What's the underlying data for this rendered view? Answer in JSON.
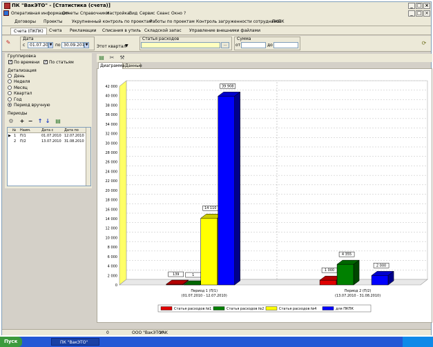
{
  "window": {
    "title": "ПК \"ВакЭТО\" - [Статистика (счета)]",
    "min": "_",
    "max": "□",
    "close": "×",
    "child_min": "_",
    "child_max": "□",
    "child_close": "×"
  },
  "menu": [
    "Оперативная информация",
    "Отчеты",
    "Справочники",
    "Настройка",
    "Вид",
    "Сервис",
    "Сеанс",
    "Окно",
    "?"
  ],
  "tabs1": [
    "Договоры",
    "Проекты",
    "Укрупненный контроль по проектам",
    "Работы по проектам",
    "Контроль загруженности сотрудников",
    "ПКПК"
  ],
  "tabs2": [
    "Счета (ПКПК)",
    "Счета",
    "Рекламации",
    "Списания в утиль",
    "Складской запас",
    "Управление внешними файлами"
  ],
  "filter": {
    "date_label": "Дата",
    "from_label": "с",
    "from": "01.07.2010",
    "to_label": "по",
    "to": "30.09.2010",
    "period": "Этот квартал",
    "expense_label": "Статья расходов",
    "expense_value": "",
    "browse": "...",
    "sum_label": "Сумма",
    "sum_from_label": "от",
    "sum_from": "",
    "sum_to_label": "до",
    "sum_to": ""
  },
  "left": {
    "grouping_label": "Группировка",
    "by_time": "По времени",
    "by_items": "По статьям",
    "detail_label": "Детализация",
    "detail_options": [
      "День",
      "Неделя",
      "Месяц",
      "Квартал",
      "Год",
      "Период вручную"
    ],
    "detail_selected_index": 5,
    "periods_label": "Периоды",
    "tool_add": "+",
    "tool_remove": "−",
    "tool_up": "↑",
    "tool_down": "↓",
    "columns": [
      "№",
      "Наим.",
      "Дата с",
      "Дата по"
    ],
    "rows": [
      [
        "1",
        "П/1",
        "01.07.2010",
        "12.07.2010"
      ],
      [
        "2",
        "П/2",
        "13.07.2010",
        "31.08.2010"
      ]
    ]
  },
  "chart_tabs": [
    "Диаграмма",
    "Данные"
  ],
  "chart_data": {
    "type": "bar",
    "categories": [
      "Период 1 (П/1)\n(01.07.2010 - 12.07.2010)",
      "Период 2 (П/2)\n(13.07.2010 - 31.08.2010)"
    ],
    "series": [
      {
        "name": "Статья расходов №1",
        "color": "#e00000",
        "values": [
          139,
          1000
        ]
      },
      {
        "name": "Статья расходов №2",
        "color": "#008000",
        "values": [
          1,
          4355
        ]
      },
      {
        "name": "Статья расходов №4",
        "color": "#ffff00",
        "values": [
          14110,
          0
        ]
      },
      {
        "name": "для ПКПК",
        "color": "#0000ff",
        "values": [
          39908,
          2000
        ]
      }
    ],
    "data_labels": [
      [
        "139",
        "1 000"
      ],
      [
        "1",
        "4 355"
      ],
      [
        "14 110",
        ""
      ],
      [
        "39 908",
        "2 000"
      ]
    ],
    "ylim": [
      0,
      42000
    ],
    "yticks": [
      "0",
      "2 000",
      "4 000",
      "6 000",
      "8 000",
      "10 000",
      "12 000",
      "14 000",
      "16 000",
      "18 000",
      "20 000",
      "22 000",
      "24 000",
      "26 000",
      "28 000",
      "30 000",
      "32 000",
      "34 000",
      "36 000",
      "38 000",
      "40 000",
      "42 000"
    ],
    "legend_position": "bottom",
    "grid": true
  },
  "status": {
    "cell1": "0",
    "company": "ООО \"ВакЭТО\"",
    "user": "VAK"
  },
  "taskbar": {
    "start": "Пуск",
    "app": "ПК \"ВакЭТО\""
  }
}
